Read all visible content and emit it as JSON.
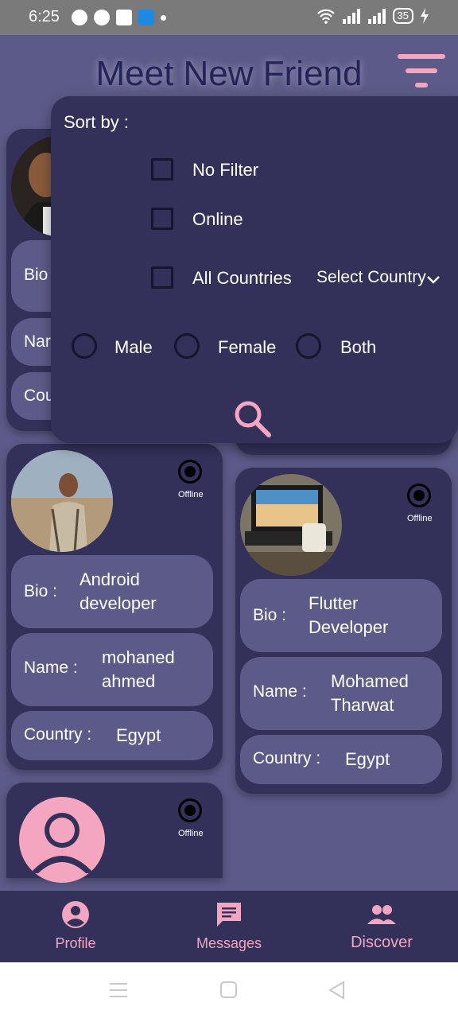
{
  "status_bar": {
    "time": "6:25",
    "battery": "35"
  },
  "header": {
    "title": "Meet New Friend"
  },
  "filter": {
    "sort_by_label": "Sort by :",
    "options": {
      "no_filter": "No Filter",
      "online": "Online",
      "all_countries": "All Countries"
    },
    "country_select": "Select Country",
    "genders": {
      "male": "Male",
      "female": "Female",
      "both": "Both"
    }
  },
  "cards": [
    {
      "status": "Offline",
      "bio_label": "Bio :",
      "bio": "Android developer",
      "name_label": "Name :",
      "name": "mohaned ahmed",
      "country_label": "Country :",
      "country": "Egypt"
    },
    {
      "status": "Offline",
      "bio_label": "Bio :",
      "bio": "Flutter Developer",
      "name_label": "Name :",
      "name": "Mohamed Tharwat",
      "country_label": "Country :",
      "country": "Egypt"
    },
    {
      "status": "Offline"
    }
  ],
  "partial_card": {
    "bio_label": "Bio",
    "name_label": "Nar",
    "country_label": "Cou"
  },
  "nav": {
    "profile": "Profile",
    "messages": "Messages",
    "discover": "Discover"
  },
  "colors": {
    "accent": "#f4a6c0",
    "background": "#5c5a88",
    "card": "#33315a"
  }
}
